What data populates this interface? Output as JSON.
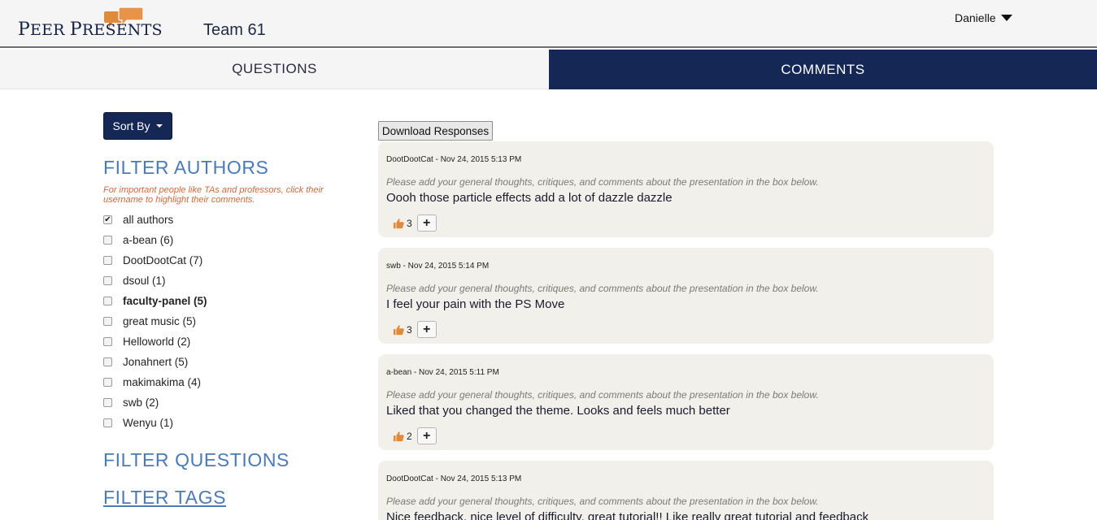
{
  "app": {
    "logo_text_first": "P",
    "logo_text_rest1": "EER ",
    "logo_text_second": "P",
    "logo_text_rest2": "RESENTS",
    "team_title": "Team 61",
    "user_name": "Danielle"
  },
  "tabs": {
    "questions": "QUESTIONS",
    "comments": "COMMENTS",
    "active": "comments"
  },
  "sidebar": {
    "sort_label": "Sort By",
    "filter_authors_heading": "FILTER AUTHORS",
    "filter_note": "For important people like TAs and professors, click their username to highlight their comments.",
    "authors": [
      {
        "label": "all authors",
        "checked": true,
        "bold": false
      },
      {
        "label": "a-bean (6)",
        "checked": false,
        "bold": false
      },
      {
        "label": "DootDootCat (7)",
        "checked": false,
        "bold": false
      },
      {
        "label": "dsoul (1)",
        "checked": false,
        "bold": false
      },
      {
        "label": "faculty-panel (5)",
        "checked": false,
        "bold": true
      },
      {
        "label": "great music (5)",
        "checked": false,
        "bold": false
      },
      {
        "label": "Helloworld (2)",
        "checked": false,
        "bold": false
      },
      {
        "label": "Jonahnert (5)",
        "checked": false,
        "bold": false
      },
      {
        "label": "makimakima (4)",
        "checked": false,
        "bold": false
      },
      {
        "label": "swb (2)",
        "checked": false,
        "bold": false
      },
      {
        "label": "Wenyu (1)",
        "checked": false,
        "bold": false
      }
    ],
    "filter_questions_heading": "FILTER QUESTIONS",
    "filter_tags_heading": "FILTER TAGS"
  },
  "main": {
    "download_label": "Download Responses",
    "comments": [
      {
        "meta": "DootDootCat - Nov 24, 2015 5:13 PM",
        "prompt": "Please add your general thoughts, critiques, and comments about the presentation in the box below.",
        "body": "Oooh those particle effects add a lot of dazzle dazzle",
        "likes": "3"
      },
      {
        "meta": "swb - Nov 24, 2015 5:14 PM",
        "prompt": "Please add your general thoughts, critiques, and comments about the presentation in the box below.",
        "body": "I feel your pain with the PS Move",
        "likes": "3"
      },
      {
        "meta": "a-bean - Nov 24, 2015 5:11 PM",
        "prompt": "Please add your general thoughts, critiques, and comments about the presentation in the box below.",
        "body": "Liked that you changed the theme. Looks and feels much better",
        "likes": "2"
      },
      {
        "meta": "DootDootCat - Nov 24, 2015 5:13 PM",
        "prompt": "Please add your general thoughts, critiques, and comments about the presentation in the box below.",
        "body": "Nice feedback, nice level of difficulty, great tutorial!! Like really great tutorial and feedback",
        "likes": ""
      }
    ]
  },
  "colors": {
    "navy": "#152754",
    "accent_orange": "#e08a3c",
    "heading_blue": "#4a7ab8",
    "card_bg": "#f1f0ea"
  },
  "icons": {
    "logo": "speech-bubbles-logo",
    "user_menu": "caret-down-icon",
    "like": "thumbs-up-icon",
    "add": "plus-icon"
  }
}
